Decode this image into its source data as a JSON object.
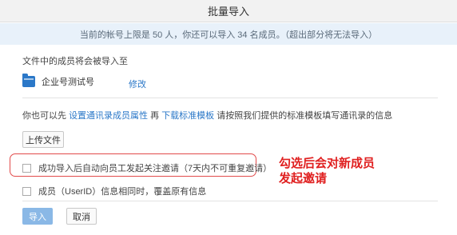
{
  "dialog": {
    "title": "批量导入",
    "notice": "当前的帐号上限是 50 人，你还可以导入 34 名成员。（超出部分将无法导入）"
  },
  "destination": {
    "label": "文件中的成员将会被导入至",
    "team_name": "企业号测试号",
    "edit_link": "修改"
  },
  "instruction": {
    "prefix": "你也可以先",
    "link1": "设置通讯录成员属性",
    "middle": "再",
    "link2": "下载标准模板",
    "suffix": "请按照我们提供的标准模板填写通讯录的信息"
  },
  "upload_button": "上传文件",
  "options": [
    {
      "label": "成功导入后自动向员工发起关注邀请（7天内不可重复邀请）",
      "checked": false
    },
    {
      "label": "成员（UserID）信息相同时，覆盖原有信息",
      "checked": false
    }
  ],
  "annotation": {
    "line1": "勾选后会对新成员",
    "line2": "发起邀请",
    "color": "#e02020"
  },
  "footer": {
    "import_button": "导入",
    "cancel_button": "取消"
  },
  "colors": {
    "link": "#2b78c8",
    "notice_bg": "#e8f1fa",
    "primary_disabled": "#8ab8e6",
    "highlight_border": "#e24b4b"
  },
  "icons": {
    "team": "folder-icon"
  }
}
